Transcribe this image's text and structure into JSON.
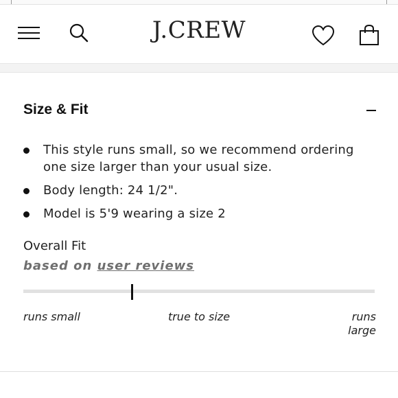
{
  "header": {
    "brand": "J.CREW",
    "icons": [
      "menu-icon",
      "search-icon",
      "heart-icon",
      "bag-icon"
    ]
  },
  "size_fit": {
    "title": "Size & Fit",
    "bullets": [
      "This style runs small, so we recommend ordering one size larger than your usual size.",
      "Body length: 24 1/2\".",
      "Model is 5'9 wearing a size 2"
    ]
  },
  "overall_fit": {
    "title": "Overall Fit",
    "based_on_prefix": "based on",
    "based_on_link": "user reviews",
    "scale": {
      "left_label": "runs small",
      "center_label": "true to size",
      "right_label": "runs large",
      "position_fraction": 0.31
    }
  }
}
